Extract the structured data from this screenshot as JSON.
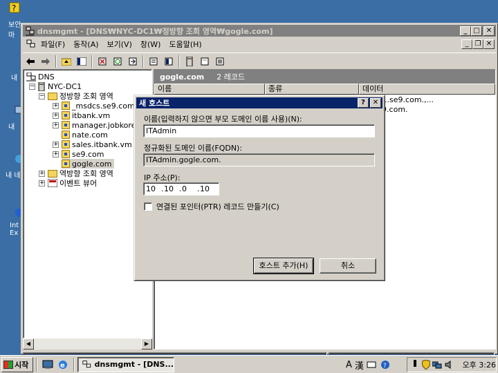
{
  "desktop": {
    "icons": [
      "보안 마",
      "내",
      "내 ",
      "내 네",
      "Int Ex"
    ]
  },
  "window": {
    "title": "dnsmgmt - [DNS₩NYC-DC1₩정방향 조회 영역₩gogle.com]",
    "buttons": {
      "minimize": "_",
      "maximize": "□",
      "close": "✕"
    }
  },
  "menu": {
    "items": [
      "파일(F)",
      "동작(A)",
      "보기(V)",
      "창(W)",
      "도움말(H)"
    ]
  },
  "tree": {
    "root": "DNS",
    "server": "NYC-DC1",
    "forward": "정방향 조회 영역",
    "zones": [
      "_msdcs.se9.com",
      "itbank.vm",
      "manager.jobkore",
      "nate.com",
      "sales.itbank.vm",
      "se9.com",
      "gogle.com"
    ],
    "reverse": "역방향 조회 영역",
    "events": "이벤트 뷰어"
  },
  "right_pane": {
    "zone": "gogle.com",
    "count": "2 레코드",
    "columns": [
      "이름",
      "종류",
      "데이터"
    ],
    "data_values": [
      "yc-dc1.se9.com.,...",
      "c1.se9.com."
    ]
  },
  "dialog": {
    "title": "새 호스트",
    "help": "?",
    "close": "✕",
    "name_label": "이름(입력하지 않으면 부모 도메인 이름 사용)(N):",
    "name_value": "ITAdmin",
    "fqdn_label": "정규화된 도메인 이름(FQDN):",
    "fqdn_value": "ITAdmin.gogle.com.",
    "ip_label": "IP 주소(P):",
    "ip_octets": [
      "10",
      "10",
      "0",
      "10"
    ],
    "ptr_label": "연결된 포인터(PTR) 레코드 만들기(C)",
    "add_button": "호스트 추가(H)",
    "cancel_button": "취소"
  },
  "taskbar": {
    "start": "시작",
    "task": "dnsmgmt - [DNS...",
    "ime_a": "A",
    "ime_han": "漢",
    "clock": "오후 3:26"
  }
}
